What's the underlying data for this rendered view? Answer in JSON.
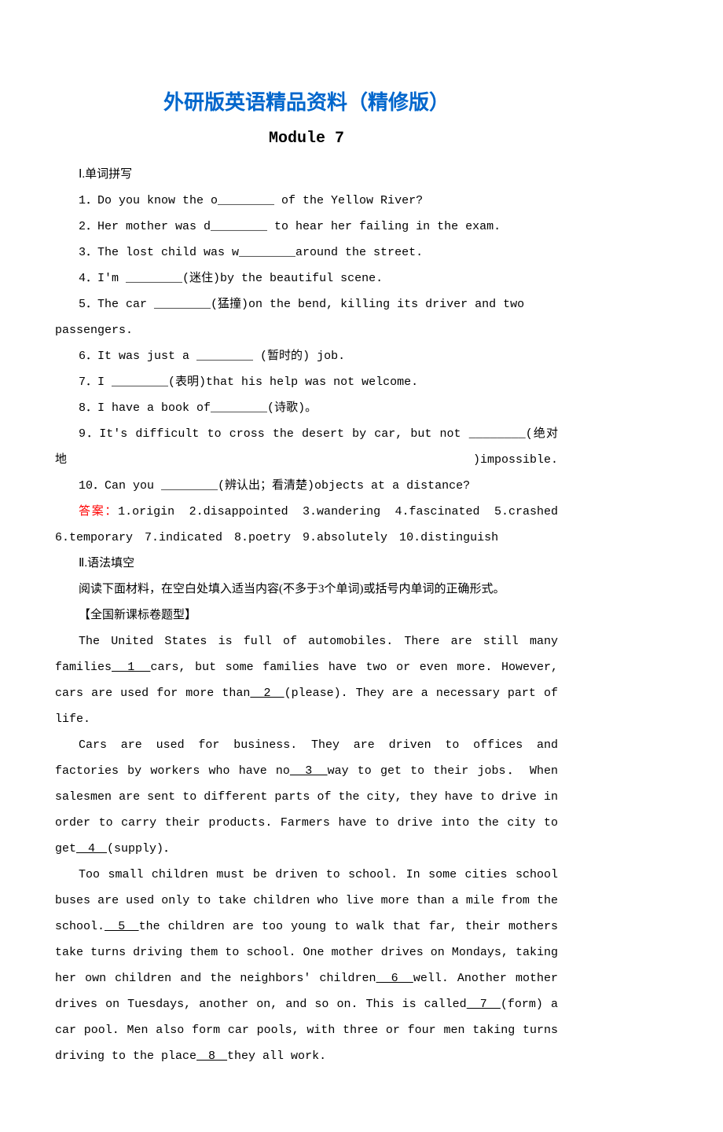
{
  "title_main": "外研版英语精品资料（精修版）",
  "title_sub": "Module 7",
  "section1_head": "Ⅰ.单词拼写",
  "q1_a": "1．Do you know the o________ of the Yellow River?",
  "q2_a": "2．Her mother was d________ to hear her failing in the exam.",
  "q3_a": "3．The lost child was w________around the street.",
  "q4_a": "4．I'm ________(",
  "q4_cn": "迷住",
  "q4_b": ")by the beautiful scene.",
  "q5_a": "5．The car ________(",
  "q5_cn": "猛撞",
  "q5_b": ")on the bend, killing its driver and two passengers.",
  "q6_a": "6．It was just a ________ (",
  "q6_cn": "暂时的",
  "q6_b": ") job.",
  "q7_a": "7．I ________(",
  "q7_cn": "表明",
  "q7_b": ")that his help was not welcome.",
  "q8_a": "8．I have a book of________(",
  "q8_cn": "诗歌",
  "q8_b": ")。",
  "q9_a": "9．It's difficult to cross the desert by car, but not ________(",
  "q9_cn": "绝对地",
  "q9_b": ")impossible.",
  "q10_a": "10．Can you ________(",
  "q10_cn": "辨认出；看清楚",
  "q10_b": ")objects at a distance?",
  "ans_label": "答案：",
  "ans_body": "1.origin　2.disappointed　3.wandering　4.fascinated　5.crashed　6.temporary　7.indicated　8.poetry　9.absolutely　10.distinguish",
  "section2_head": "Ⅱ.语法填空",
  "section2_desc": "阅读下面材料，在空白处填入适当内容(不多于3个单词)或括号内单词的正确形式。",
  "section2_tag": "【全国新课标卷题型】",
  "p1_a": "The United States is full of automobiles. There are still many families",
  "b1": "　1　",
  "p1_b": "cars, but some families have two or even more. However, cars are used for more than",
  "b2": "　2　",
  "p1_c": "(please). They are a necessary part of life.",
  "p2_a": "Cars are used for business. They are driven to offices and factories by workers who have no",
  "b3": "　3　",
  "p2_b": "way to get to their jobs． When salesmen are sent to different parts of the city, they have to drive in order to carry their products. Farmers have to drive into the city to get",
  "b4": "　4　",
  "p2_c": "(supply)．",
  "p3_a": "Too small children must be driven to school. In some cities school buses are used only to take children who live more than a mile from the school.",
  "b5": "　5　",
  "p3_b": "the children are too young to walk that far, their mothers take turns driving them to school. One mother drives on Mondays, taking her own children and the neighbors' children",
  "b6": "　6　",
  "p3_c": "well. Another mother drives on Tuesdays, another on, and so on. This is called",
  "b7": "　7　",
  "p3_d": "(form) a car pool. Men also form car pools, with three or four men taking turns driving to the place",
  "b8": "　8　",
  "p3_e": "they all work."
}
